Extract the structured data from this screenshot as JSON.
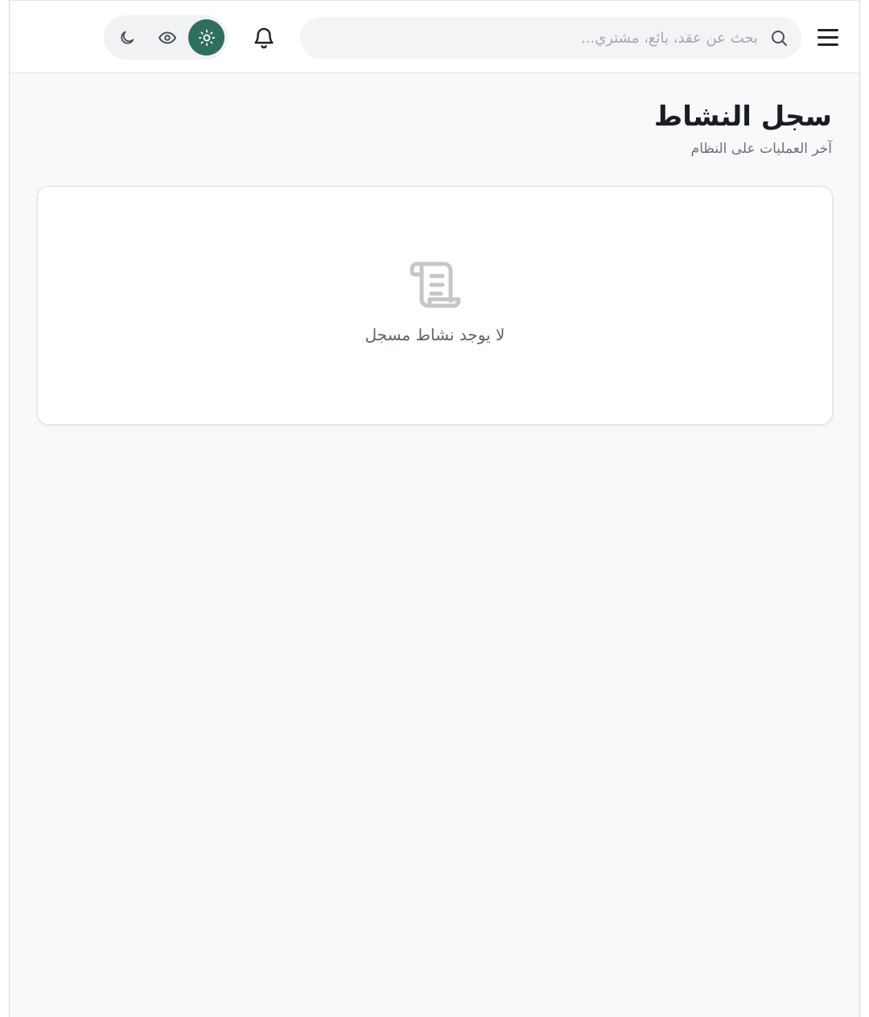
{
  "header": {
    "menu_label": "",
    "search": {
      "placeholder": "بحث عن عقد، بائع، مشتري...",
      "value": ""
    },
    "icons": {
      "menu": "hamburger-menu-icon",
      "search": "search-icon",
      "notifications": "bell-icon",
      "theme_dark": "moon-icon",
      "theme_eye": "eye-icon",
      "theme_light": "sun-icon"
    },
    "active_theme": "light"
  },
  "page": {
    "title": "سجل النشاط",
    "subtitle": "آخر العمليات على النظام"
  },
  "empty_state": {
    "icon": "scroll-icon",
    "message": "لا يوجد نشاط مسجل"
  },
  "colors": {
    "accent": "#2f6f60",
    "background": "#f8f9fb",
    "card": "#ffffff",
    "muted_text": "#6b7078",
    "icon_muted": "#c4c6c9"
  }
}
